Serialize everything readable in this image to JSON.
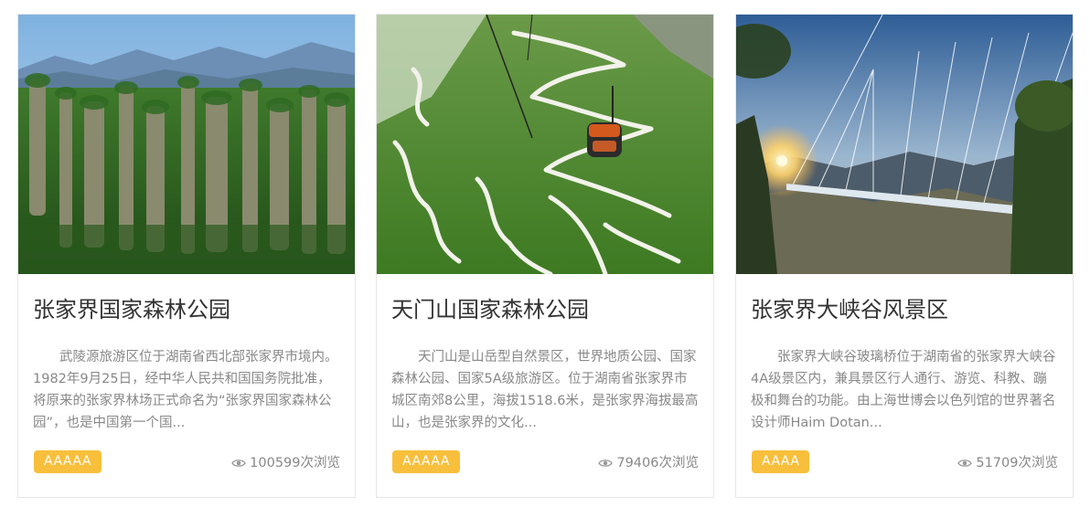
{
  "cards": [
    {
      "title": "张家界国家森林公园",
      "desc": "武陵源旅游区位于湖南省西北部张家界市境内。1982年9月25日，经中华人民共和国国务院批准，将原来的张家界林场正式命名为“张家界国家森林公园”，也是中国第一个国...",
      "badge": "AAAAA",
      "views": "100599次浏览",
      "image": "sandstone-pillar-forest-mountains"
    },
    {
      "title": "天门山国家森林公园",
      "desc": "天门山是山岳型自然景区，世界地质公园、国家森林公园、国家5A级旅游区。位于湖南省张家界市城区南郊8公里，海拔1518.6米，是张家界海拔最高山，也是张家界的文化...",
      "badge": "AAAAA",
      "views": "79406次浏览",
      "image": "cable-car-over-winding-road"
    },
    {
      "title": "张家界大峡谷风景区",
      "desc": "张家界大峡谷玻璃桥位于湖南省的张家界大峡谷4A级景区内，兼具景区行人通行、游览、科教、蹦极和舞台的功能。由上海世博会以色列馆的世界著名设计师Haim Dotan...",
      "badge": "AAAA",
      "views": "51709次浏览",
      "image": "glass-bridge-at-sunset"
    }
  ],
  "colors": {
    "badge": "#f7bf3b",
    "title": "#333333",
    "muted": "#888888",
    "border": "#e6e6e6"
  },
  "icons": {
    "views": "eye-icon"
  }
}
